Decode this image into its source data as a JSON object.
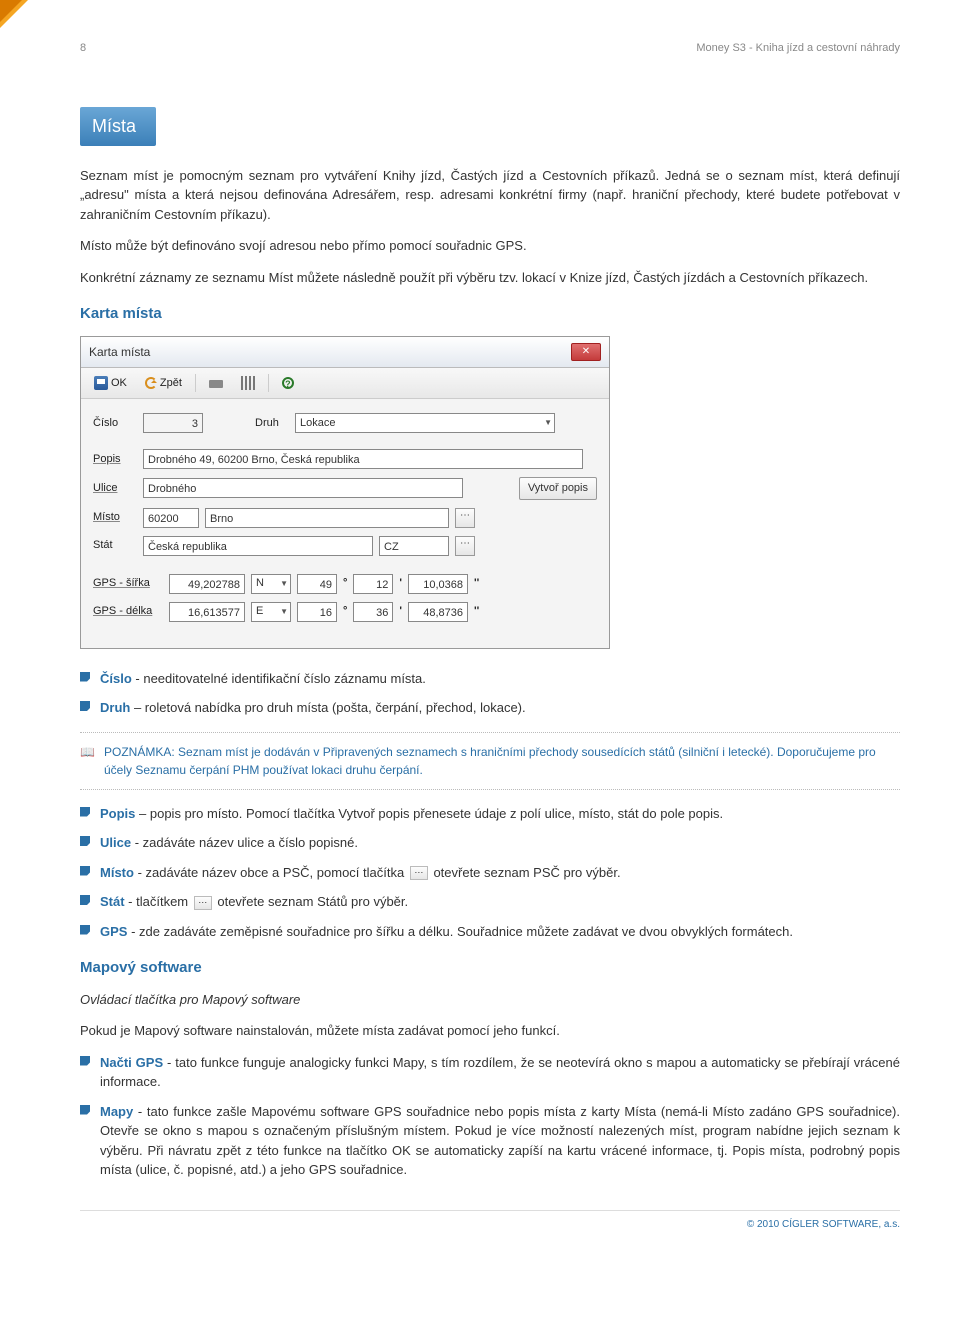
{
  "pageNumber": "8",
  "runningHeader": "Money S3 - Kniha jízd a cestovní náhrady",
  "sectionTitle": "Místa",
  "intro": [
    "Seznam míst je pomocným seznam pro vytváření Knihy jízd, Častých jízd a Cestovních příkazů. Jedná se o seznam míst, která definují „adresu\" místa a která nejsou definována Adresářem, resp. adresami konkrétní firmy (např. hraniční přechody, které budete potřebovat v zahraničním Cestovním příkazu).",
    "Místo může být definováno svojí adresou nebo přímo pomocí souřadnic GPS.",
    "Konkrétní záznamy ze seznamu Míst můžete následně použít při výběru tzv. lokací v Knize jízd, Častých jízdách a Cestovních příkazech."
  ],
  "subheading": "Karta místa",
  "dialog": {
    "title": "Karta místa",
    "toolbar": {
      "ok": "OK",
      "back": "Zpět"
    },
    "labels": {
      "cislo": "Číslo",
      "druh": "Druh",
      "popis": "Popis",
      "ulice": "Ulice",
      "misto": "Místo",
      "stat": "Stát",
      "gpsSirka": "GPS - šířka",
      "gpsDelka": "GPS - délka",
      "vytvorPopis": "Vytvoř popis"
    },
    "values": {
      "cislo": "3",
      "druh": "Lokace",
      "popis": "Drobného 49, 60200 Brno, Česká republika",
      "ulice": "Drobného",
      "mistoPsc": "60200",
      "mistoObec": "Brno",
      "statNazev": "Česká republika",
      "statKod": "CZ",
      "sirkaDec": "49,202788",
      "sirkaHem": "N",
      "sirkaDeg": "49",
      "sirkaMin": "12",
      "sirkaSec": "10,0368",
      "delkaDec": "16,613577",
      "delkaHem": "E",
      "delkaDeg": "16",
      "delkaMin": "36",
      "delkaSec": "48,8736"
    }
  },
  "bullets1": {
    "cislo": {
      "lead": "Číslo",
      "text": " - needitovatelné identifikační číslo záznamu místa."
    },
    "druh": {
      "lead": "Druh",
      "text": " – roletová nabídka pro druh místa (pošta, čerpání, přechod, lokace)."
    }
  },
  "note": "POZNÁMKA: Seznam míst je dodáván v Připravených seznamech s hraničními přechody sousedících států (silniční i letecké). Doporučujeme pro účely Seznamu čerpání PHM používat lokaci druhu čerpání.",
  "bullets2": {
    "popis": {
      "lead": "Popis",
      "text": " – popis pro místo. Pomocí tlačítka Vytvoř popis přenesete údaje z polí ulice, místo, stát do pole popis."
    },
    "ulice": {
      "lead": "Ulice",
      "text": " - zadáváte název ulice a číslo popisné."
    },
    "misto": {
      "lead": "Místo",
      "pre": " - zadáváte název obce a PSČ, pomocí tlačítka ",
      "post": " otevřete seznam PSČ pro výběr."
    },
    "stat": {
      "lead": "Stát",
      "pre": " - tlačítkem ",
      "post": " otevřete seznam Států pro výběr."
    },
    "gps": {
      "lead": "GPS",
      "text": " - zde zadáváte zeměpisné souřadnice pro šířku a délku. Souřadnice můžete zadávat ve dvou obvyklých formátech."
    }
  },
  "mapHeading": "Mapový software",
  "mapIntro1": "Ovládací tlačítka pro Mapový software",
  "mapIntro2": "Pokud je Mapový software nainstalován, můžete místa zadávat pomocí jeho funkcí.",
  "bullets3": {
    "nactiGps": {
      "lead": "Načti GPS",
      "text": " - tato funkce funguje analogicky funkci Mapy, s tím rozdílem, že se neotevírá okno s mapou a automaticky se přebírají vrácené informace."
    },
    "mapy": {
      "lead": "Mapy",
      "text": " - tato funkce zašle Mapovému software GPS souřadnice nebo popis místa z karty Místa (nemá-li Místo zadáno GPS souřadnice). Otevře se okno s mapou s označeným příslušným místem. Pokud je více možností nalezených míst, program nabídne jejich seznam k výběru. Při návratu zpět z této funkce na tlačítko OK se automaticky zapíší na kartu vrácené informace, tj. Popis místa, podrobný popis místa (ulice, č. popisné, atd.) a jeho GPS souřadnice."
    }
  },
  "footer": "© 2010 CÍGLER SOFTWARE, a.s."
}
